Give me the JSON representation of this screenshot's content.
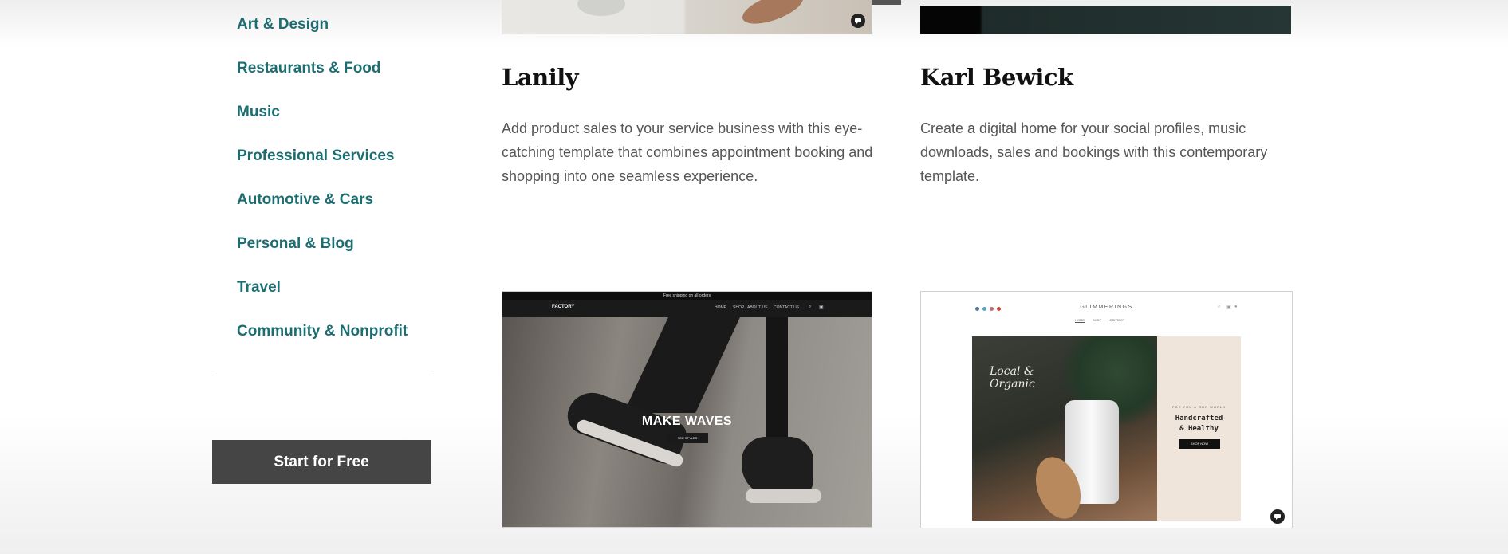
{
  "sidebar": {
    "categories": [
      "Art & Design",
      "Restaurants & Food",
      "Music",
      "Professional Services",
      "Automotive & Cars",
      "Personal & Blog",
      "Travel",
      "Community & Nonprofit"
    ],
    "cta_label": "Start for Free"
  },
  "cards": {
    "lanily": {
      "title": "Lanily",
      "description": "Add product sales to your service business with this eye-catching template that combines appointment booking and shopping into one seamless experience."
    },
    "karl": {
      "title": "Karl Bewick",
      "description": "Create a digital home for your social profiles, music downloads, sales and bookings with this contemporary template."
    },
    "factory": {
      "banner": "Free shipping on all orders",
      "logo": "FACTORY",
      "nav": [
        "HOME",
        "SHOP",
        "ABOUT US",
        "CONTACT US"
      ],
      "headline": "MAKE WAVES",
      "button": "SEE STYLES"
    },
    "glimmerings": {
      "logo": "GLIMMERINGS",
      "nav": [
        "HOME",
        "SHOP",
        "CONTACT"
      ],
      "script_text": "Local & Organic",
      "eyebrow": "FOR YOU & OUR WORLD",
      "headline_line1": "Handcrafted",
      "headline_line2": "& Healthy",
      "button": "SHOP NOW"
    }
  },
  "colors": {
    "link": "#1d6e72",
    "cta_bg": "#454545"
  }
}
